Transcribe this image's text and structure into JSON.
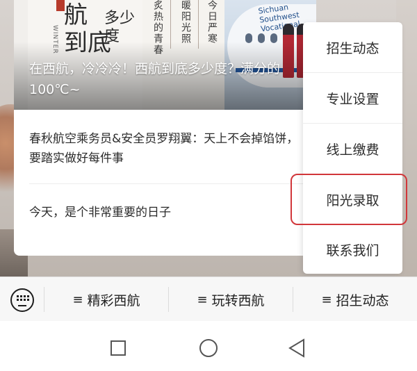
{
  "article": {
    "banner": {
      "poster_char_1": "航",
      "poster_char_2": "到底",
      "poster_winter": "WINTER",
      "poster_duo": "多少度",
      "poem_lines": [
        "炙热的青春",
        "暖阳光照",
        "今日严寒"
      ],
      "plane_text": "Sichuan Southwest Vocational",
      "title": "在西航，冷冷冷！西航到底多少度？满分的100℃~"
    },
    "items": [
      {
        "text": "春秋航空乘务员&安全员罗翔翼：天上不会掉馅饼，要踏实做好每件事"
      },
      {
        "text": "今天，是个非常重要的日子"
      }
    ]
  },
  "menu": {
    "items": [
      {
        "label": "招生动态"
      },
      {
        "label": "专业设置"
      },
      {
        "label": "线上缴费"
      },
      {
        "label": "阳光录取"
      },
      {
        "label": "联系我们"
      }
    ],
    "highlighted_index": 3,
    "highlight_color": "#d1363a"
  },
  "tabbar": {
    "tabs": [
      {
        "icon": "menu-icon",
        "label": "精彩西航"
      },
      {
        "icon": "menu-icon",
        "label": "玩转西航"
      },
      {
        "icon": "menu-icon",
        "label": "招生动态"
      }
    ],
    "hamburger_glyph": "≡"
  },
  "navbar": {
    "buttons": [
      "square-icon",
      "circle-icon",
      "triangle-back-icon"
    ]
  }
}
